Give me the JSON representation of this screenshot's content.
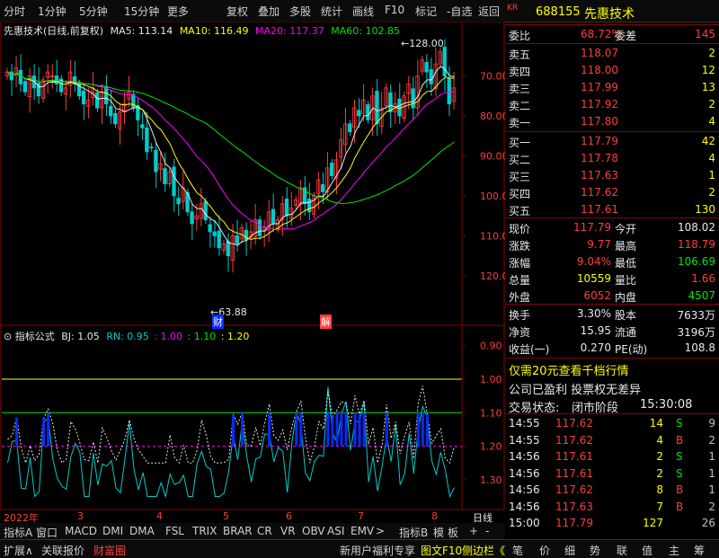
{
  "toolbar": {
    "left": [
      "分时",
      "1分钟",
      "5分钟",
      "15分钟",
      "更多"
    ],
    "right": [
      "复权",
      "叠加",
      "多股",
      "统计",
      "画线",
      "F10",
      "标记",
      "-自选",
      "返回"
    ]
  },
  "chart_header": {
    "title": "先惠技术(日线,前复权)",
    "ma5": "MA5: 113.14",
    "ma10": "MA10: 116.49",
    "ma20": "MA20: 117.37",
    "ma60": "MA60: 102.85",
    "max_label": "128.00",
    "min_label": "63.88"
  },
  "price_axis": [
    "120.0",
    "110.0",
    "100.0",
    "90.00",
    "80.00",
    "70.00"
  ],
  "indicator_header": {
    "name": "指标公式",
    "bj": "BJ: 1.05",
    "rn": "RN: 0.95",
    "v1": ": 1.00",
    "v2": ": 1.10",
    "v3": ": 1.20"
  },
  "indicator_axis": [
    "1.30",
    "1.20",
    "1.10",
    "1.00",
    "0.90"
  ],
  "markers": {
    "cai": "财",
    "jie": "解"
  },
  "date_axis": [
    "2022年",
    "3",
    "4",
    "5",
    "6",
    "7",
    "8"
  ],
  "date_axis_right": "日线",
  "tabs": [
    "指标A",
    "窗口",
    "MACD",
    "DMI",
    "DMA",
    "FSL",
    "TRIX",
    "BRAR",
    "CR",
    "VR",
    "OBV",
    "ASI",
    "EMV",
    ">",
    "指标B",
    "模",
    "板",
    "+",
    "-"
  ],
  "bottom_bar": {
    "left": [
      "扩展∧",
      "关联报价",
      "财富圈"
    ],
    "middle": "新用户福利专享",
    "f10": "图文F10",
    "side": "侧边栏《",
    "right": [
      "笔",
      "价",
      "细",
      "势",
      "联",
      "值",
      "主",
      "筹"
    ]
  },
  "stock": {
    "badge": "KR",
    "code": "688155",
    "name": "先惠技术"
  },
  "weibi": {
    "label": "委比",
    "value": "68.72%",
    "label2": "委差",
    "value2": "145"
  },
  "asks": [
    {
      "label": "卖五",
      "price": "118.07",
      "vol": "2"
    },
    {
      "label": "卖四",
      "price": "118.00",
      "vol": "12"
    },
    {
      "label": "卖三",
      "price": "117.99",
      "vol": "13"
    },
    {
      "label": "卖二",
      "price": "117.92",
      "vol": "2"
    },
    {
      "label": "卖一",
      "price": "117.80",
      "vol": "4"
    }
  ],
  "bids": [
    {
      "label": "买一",
      "price": "117.79",
      "vol": "42"
    },
    {
      "label": "买二",
      "price": "117.78",
      "vol": "4"
    },
    {
      "label": "买三",
      "price": "117.63",
      "vol": "1"
    },
    {
      "label": "买四",
      "price": "117.62",
      "vol": "2"
    },
    {
      "label": "买五",
      "price": "117.61",
      "vol": "130"
    }
  ],
  "quote": [
    {
      "l1": "现价",
      "v1": "117.79",
      "c1": "red",
      "l2": "今开",
      "v2": "108.02",
      "c2": "white"
    },
    {
      "l1": "涨跌",
      "v1": "9.77",
      "c1": "red",
      "l2": "最高",
      "v2": "118.79",
      "c2": "red"
    },
    {
      "l1": "涨幅",
      "v1": "9.04%",
      "c1": "red",
      "l2": "最低",
      "v2": "106.69",
      "c2": "green"
    },
    {
      "l1": "总量",
      "v1": "10559",
      "c1": "yellow",
      "l2": "量比",
      "v2": "1.66",
      "c2": "red"
    },
    {
      "l1": "外盘",
      "v1": "6052",
      "c1": "red",
      "l2": "内盘",
      "v2": "4507",
      "c2": "green"
    }
  ],
  "stats": [
    {
      "l1": "换手",
      "v1": "3.30%",
      "l2": "股本",
      "v2": "7633万"
    },
    {
      "l1": "净资",
      "v1": "15.95",
      "l2": "流通",
      "v2": "3196万"
    },
    {
      "l1": "收益(一)",
      "v1": "0.270",
      "l2": "PE(动)",
      "v2": "108.8"
    }
  ],
  "promo1": "仅需20元查看千档行情",
  "promo2": "公司已盈利 投票权无差异",
  "status": {
    "label": "交易状态:",
    "value": "闭市阶段",
    "time": "15:30:08"
  },
  "ticks": [
    {
      "time": "14:55",
      "price": "117.62",
      "vol": "14",
      "side": "S",
      "n": "9"
    },
    {
      "time": "14:55",
      "price": "117.62",
      "vol": "4",
      "side": "B",
      "n": "2"
    },
    {
      "time": "14:56",
      "price": "117.61",
      "vol": "2",
      "side": "S",
      "n": "1"
    },
    {
      "time": "14:56",
      "price": "117.61",
      "vol": "2",
      "side": "S",
      "n": "1"
    },
    {
      "time": "14:56",
      "price": "117.62",
      "vol": "8",
      "side": "B",
      "n": "1"
    },
    {
      "time": "14:56",
      "price": "117.63",
      "vol": "7",
      "side": "B",
      "n": "2"
    },
    {
      "time": "15:00",
      "price": "117.79",
      "vol": "127",
      "side": "",
      "n": "26"
    }
  ],
  "chart_data": {
    "type": "candlestick",
    "price_ylim": [
      63,
      130
    ],
    "price_ticks": [
      70,
      80,
      90,
      100,
      110,
      120
    ],
    "close": [
      121,
      119,
      122,
      118,
      116,
      120,
      117,
      115,
      119,
      121,
      120,
      118,
      116,
      117,
      121,
      118,
      115,
      113,
      114,
      117,
      112,
      116,
      113,
      110,
      108,
      111,
      113,
      116,
      112,
      109,
      107,
      101,
      102,
      96,
      98,
      93,
      96,
      90,
      88,
      92,
      86,
      83,
      85,
      88,
      84,
      81,
      80,
      77,
      78,
      75,
      80,
      78,
      82,
      79,
      81,
      84,
      80,
      82,
      86,
      83,
      84,
      88,
      85,
      87,
      89,
      92,
      88,
      86,
      90,
      94,
      91,
      97,
      95,
      99,
      104,
      108,
      106,
      112,
      110,
      114,
      109,
      115,
      108,
      112,
      117,
      111,
      113,
      110,
      115,
      118,
      112,
      120,
      124,
      121,
      118,
      123,
      126,
      120,
      113,
      117
    ],
    "high_label": 128.0,
    "low_label": 63.88,
    "ma_colors": {
      "ma5": "#e8e8e8",
      "ma10": "#ffff00",
      "ma20": "#ff00ff",
      "ma60": "#00e600"
    },
    "ma_last": {
      "ma5": 113.14,
      "ma10": 116.49,
      "ma20": 117.37,
      "ma60": 102.85
    },
    "indicator_ylim": [
      0.83,
      1.35
    ],
    "indicator_ticks": [
      0.9,
      1.0,
      1.1,
      1.2,
      1.3
    ],
    "indicator_lines": {
      "bj": 1.05,
      "rn": 0.95,
      "l1": 1.0,
      "l2": 1.1,
      "l3": 1.2
    },
    "colors": {
      "up": "#ff3c3c",
      "down": "#00cccc",
      "border": "#8b0000",
      "indicator": "#00cccc",
      "dash": "#e8e8e8",
      "blue": "#0a2bff"
    }
  }
}
